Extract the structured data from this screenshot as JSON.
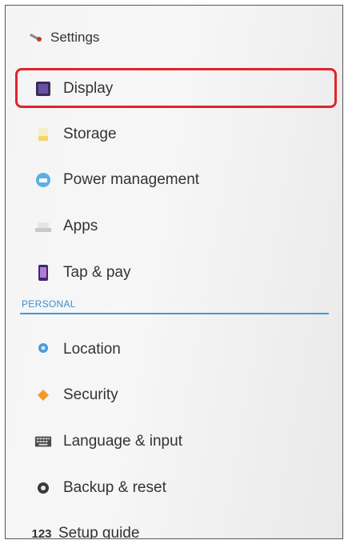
{
  "header": {
    "title": "Settings",
    "icon": "settings-wrench-icon"
  },
  "items_device": [
    {
      "label": "Display",
      "icon": "display-icon",
      "highlighted": true
    },
    {
      "label": "Storage",
      "icon": "storage-icon"
    },
    {
      "label": "Power management",
      "icon": "power-management-icon"
    },
    {
      "label": "Apps",
      "icon": "apps-icon"
    },
    {
      "label": "Tap & pay",
      "icon": "tap-pay-icon"
    }
  ],
  "section_personal": "PERSONAL",
  "items_personal": [
    {
      "label": "Location",
      "icon": "location-icon"
    },
    {
      "label": "Security",
      "icon": "security-icon"
    },
    {
      "label": "Language & input",
      "icon": "keyboard-icon"
    },
    {
      "label": "Backup & reset",
      "icon": "backup-icon"
    },
    {
      "label": "Setup guide",
      "icon": "setup-guide-icon"
    }
  ],
  "colors": {
    "highlight": "#e0232c",
    "section_accent": "#3a9be0"
  }
}
